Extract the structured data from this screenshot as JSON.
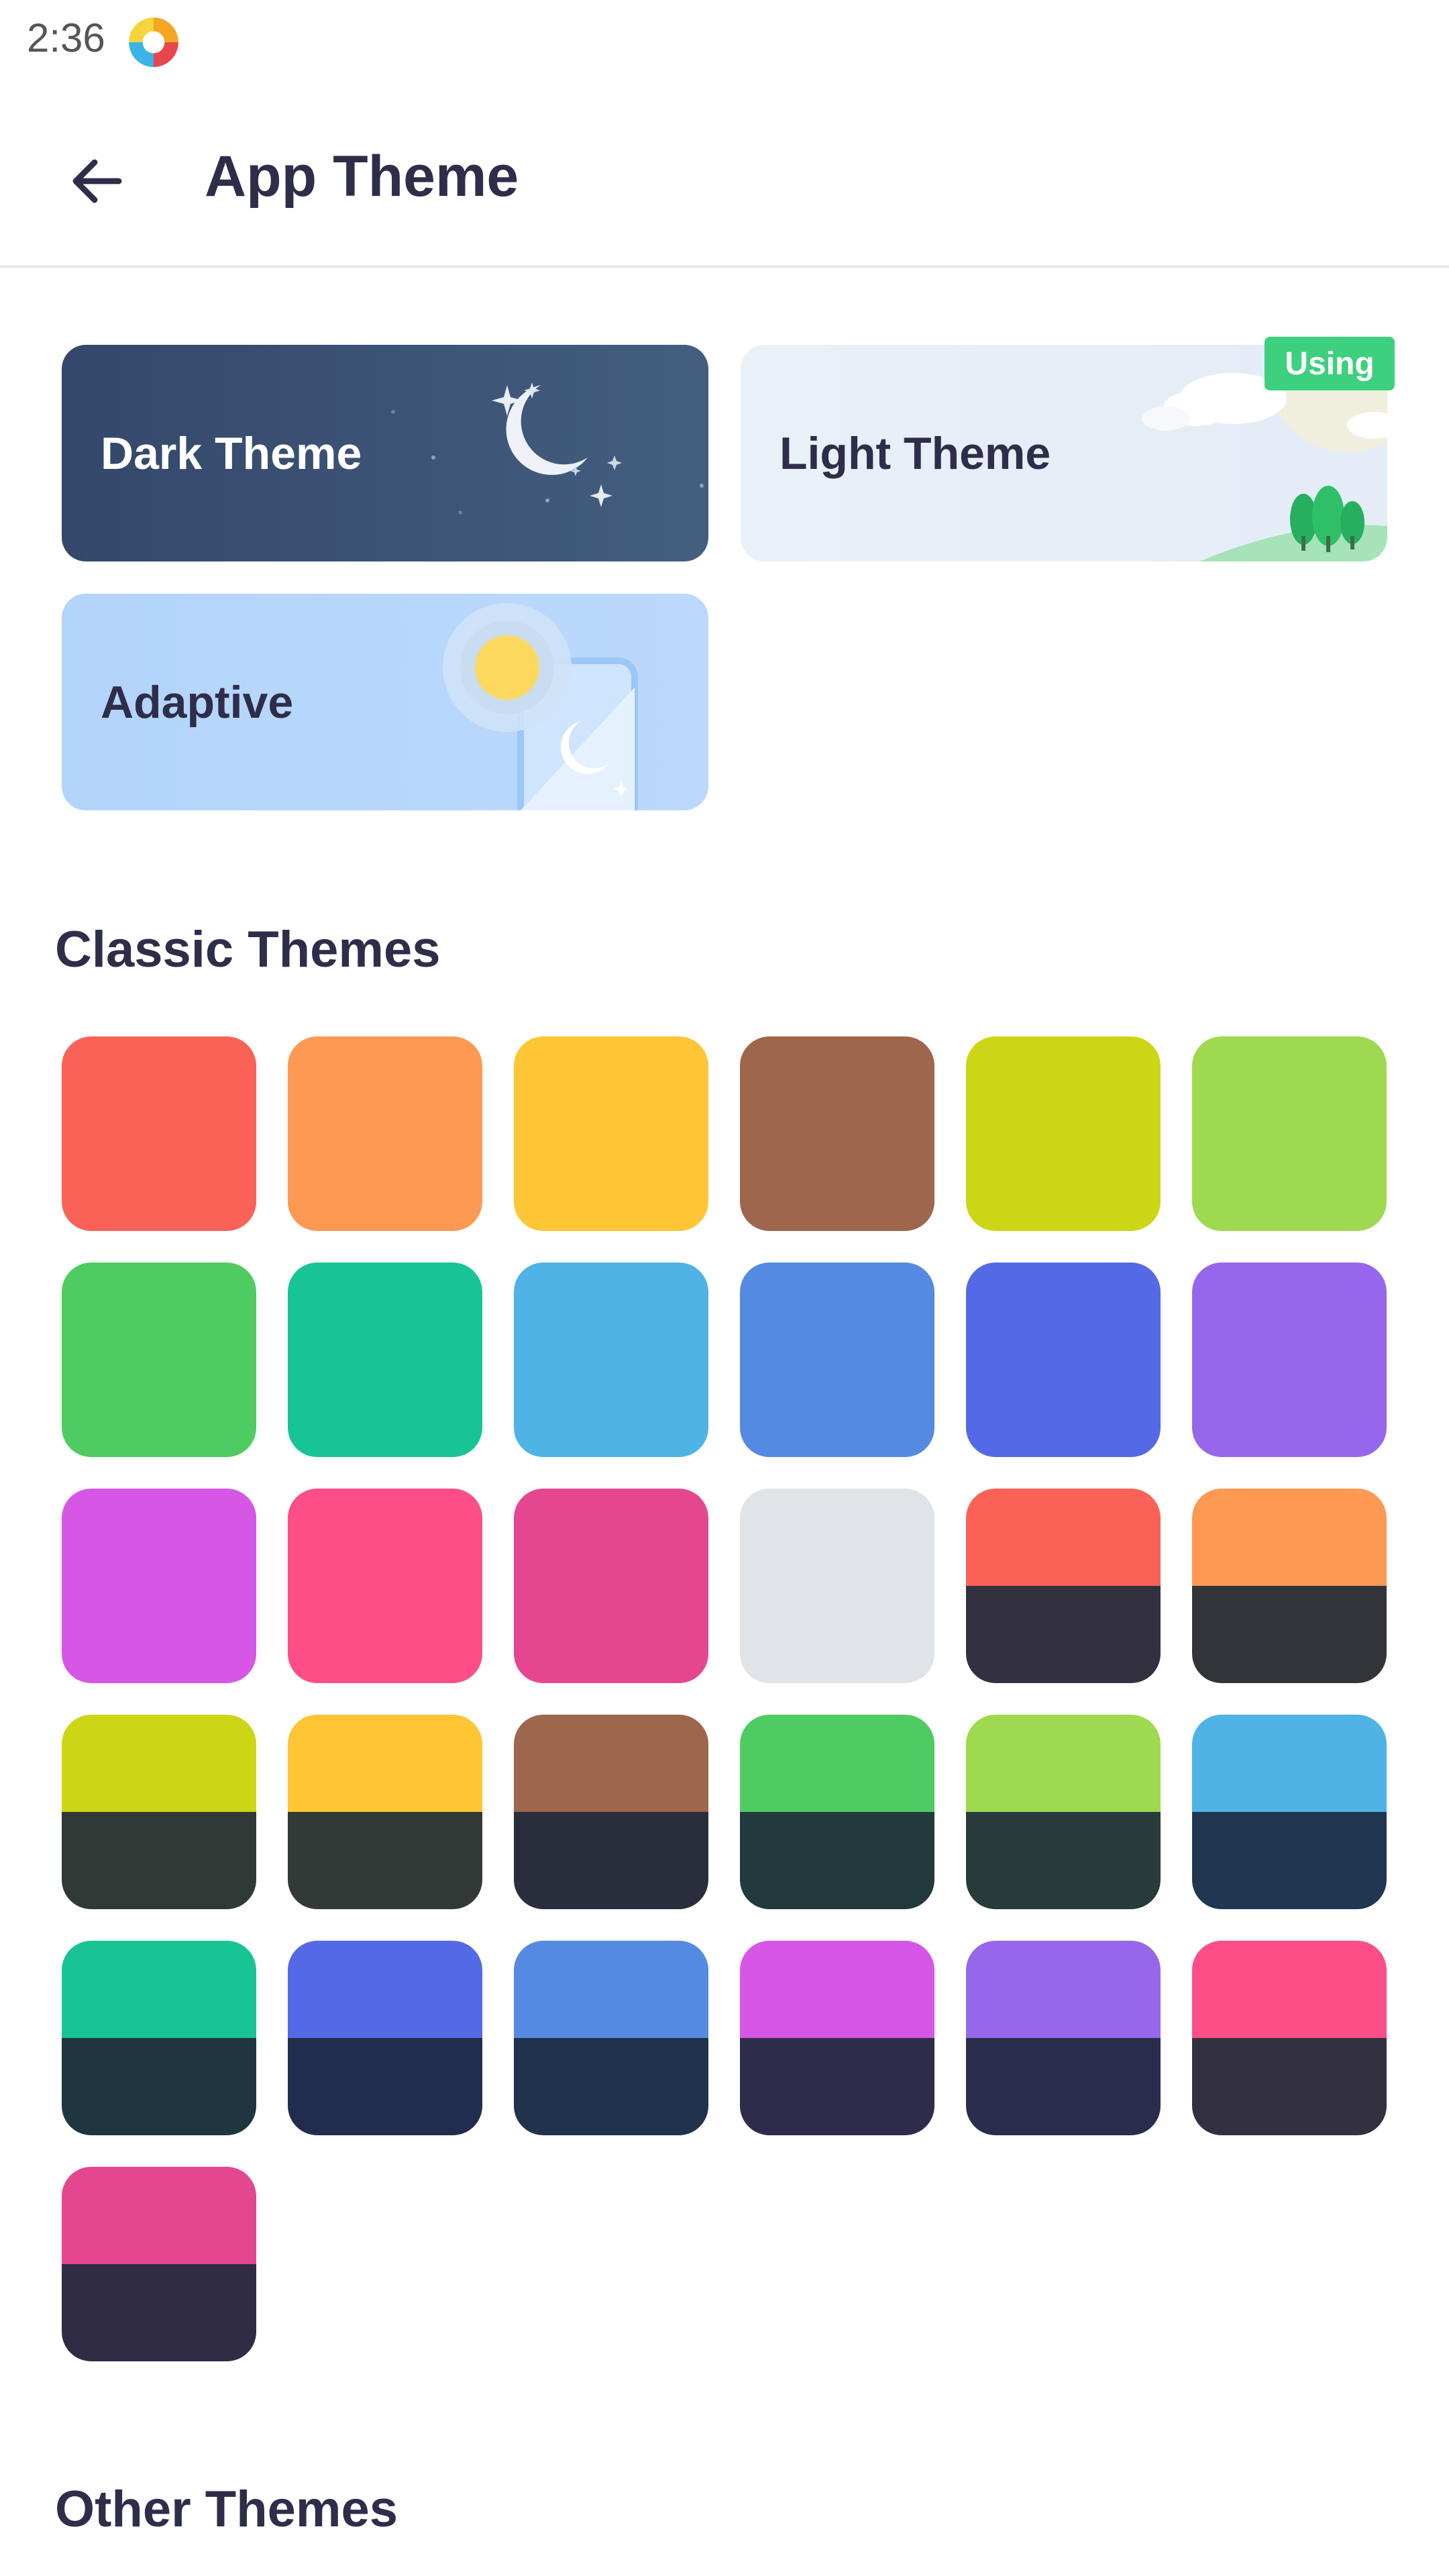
{
  "status_bar": {
    "time": "2:36"
  },
  "toolbar": {
    "back_icon": "arrow-left-icon",
    "title": "App Theme"
  },
  "modes": {
    "dark_label": "Dark Theme",
    "light_label": "Light Theme",
    "adaptive_label": "Adaptive",
    "using_badge": "Using",
    "selected": "light"
  },
  "classic": {
    "title": "Classic Themes",
    "swatches": [
      {
        "top": "#fa6257",
        "bottom": null
      },
      {
        "top": "#fe9953",
        "bottom": null
      },
      {
        "top": "#fec535",
        "bottom": null
      },
      {
        "top": "#9e664c",
        "bottom": null
      },
      {
        "top": "#cdd615",
        "bottom": null
      },
      {
        "top": "#9fd94f",
        "bottom": null
      },
      {
        "top": "#4fcc61",
        "bottom": null
      },
      {
        "top": "#19c494",
        "bottom": null
      },
      {
        "top": "#4fb3e6",
        "bottom": null
      },
      {
        "top": "#548ae2",
        "bottom": null
      },
      {
        "top": "#5469e6",
        "bottom": null
      },
      {
        "top": "#9667eb",
        "bottom": null
      },
      {
        "top": "#d657e6",
        "bottom": null
      },
      {
        "top": "#fe4e88",
        "bottom": null
      },
      {
        "top": "#e54690",
        "bottom": null
      },
      {
        "top": "#e0e4e8",
        "bottom": null
      },
      {
        "top": "#fa6257",
        "bottom": "#33313f"
      },
      {
        "top": "#fe9953",
        "bottom": "#33343a"
      },
      {
        "top": "#cdd615",
        "bottom": "#2f3935"
      },
      {
        "top": "#fec535",
        "bottom": "#333936"
      },
      {
        "top": "#9e664c",
        "bottom": "#2a2e3c"
      },
      {
        "top": "#4fcc61",
        "bottom": "#223a3e"
      },
      {
        "top": "#9fd94f",
        "bottom": "#283a3a"
      },
      {
        "top": "#4fb3e6",
        "bottom": "#213650"
      },
      {
        "top": "#19c494",
        "bottom": "#1f3540"
      },
      {
        "top": "#5469e6",
        "bottom": "#202d4f"
      },
      {
        "top": "#548ae2",
        "bottom": "#21324c"
      },
      {
        "top": "#d657e6",
        "bottom": "#2f2c4b"
      },
      {
        "top": "#9667eb",
        "bottom": "#2a2c4c"
      },
      {
        "top": "#fe4e88",
        "bottom": "#33303f"
      },
      {
        "top": "#e54690",
        "bottom": "#302c45"
      }
    ]
  },
  "other": {
    "title": "Other Themes"
  }
}
